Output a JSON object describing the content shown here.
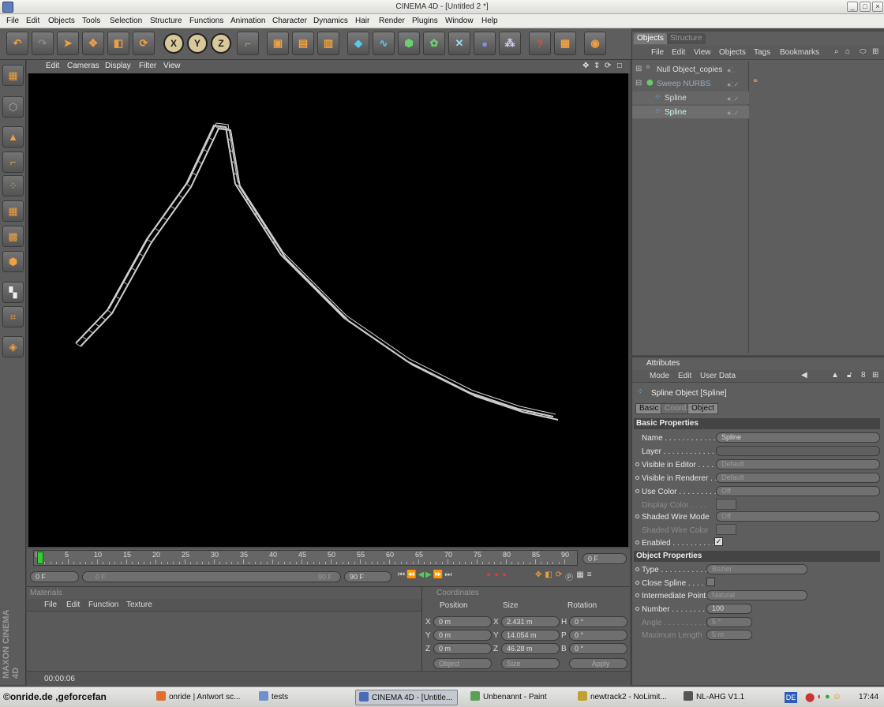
{
  "window": {
    "title": "CINEMA 4D - [Untitled 2 *]"
  },
  "menubar": [
    "File",
    "Edit",
    "Objects",
    "Tools",
    "Selection",
    "Structure",
    "Functions",
    "Animation",
    "Character",
    "Dynamics",
    "Hair",
    "Render",
    "Plugins",
    "Window",
    "Help"
  ],
  "viewport": {
    "menu": [
      "Edit",
      "Cameras",
      "Display",
      "Filter",
      "View"
    ]
  },
  "timeline": {
    "ticks": [
      "0",
      "5",
      "10",
      "15",
      "20",
      "25",
      "30",
      "35",
      "40",
      "45",
      "50",
      "55",
      "60",
      "65",
      "70",
      "75",
      "80",
      "85",
      "90"
    ],
    "current_frame": "0 F",
    "start_field": "0 F",
    "range_left": "0 F",
    "range_right": "90 F",
    "end_field": "90 F"
  },
  "materials": {
    "title": "Materials",
    "menu": [
      "File",
      "Edit",
      "Function",
      "Texture"
    ]
  },
  "coordinates": {
    "title": "Coordinates",
    "headers": [
      "Position",
      "Size",
      "Rotation"
    ],
    "rows": [
      {
        "axis": "X",
        "pos": "0 m",
        "saxis": "X",
        "size": "2.431 m",
        "raxis": "H",
        "rot": "0 °"
      },
      {
        "axis": "Y",
        "pos": "0 m",
        "saxis": "Y",
        "size": "14.054 m",
        "raxis": "P",
        "rot": "0 °"
      },
      {
        "axis": "Z",
        "pos": "0 m",
        "saxis": "Z",
        "size": "46.28 m",
        "raxis": "B",
        "rot": "0 °"
      }
    ],
    "mode": "Object",
    "size_mode": "Size",
    "apply": "Apply"
  },
  "status": {
    "time": "00:00:06"
  },
  "objects": {
    "tabs": [
      "Objects",
      "Structure"
    ],
    "menu": [
      "File",
      "Edit",
      "View",
      "Objects",
      "Tags",
      "Bookmarks"
    ],
    "items": [
      {
        "name": "Null Object_copies"
      },
      {
        "name": "Sweep NURBS"
      },
      {
        "name": "Spline"
      },
      {
        "name": "Spline"
      }
    ]
  },
  "attributes": {
    "title": "Attributes",
    "menu": [
      "Mode",
      "Edit",
      "User Data"
    ],
    "object_title": "Spline Object [Spline]",
    "tabs": [
      "Basic",
      "Coord.",
      "Object"
    ],
    "basic_header": "Basic Properties",
    "name_label": "Name . . . . . . . . . . . .",
    "name_value": "Spline",
    "layer_label": "Layer . . . . . . . . . . . .",
    "vis_editor_label": "Visible in Editor . . . . .",
    "vis_editor_value": "Default",
    "vis_render_label": "Visible in Renderer . .",
    "vis_render_value": "Default",
    "use_color_label": "Use Color . . . . . . . . .",
    "use_color_value": "Off",
    "display_color_label": "Display Color . . . .",
    "shaded_wire_label": "Shaded Wire Mode",
    "shaded_wire_value": "Off",
    "shaded_wire_color_label": "Shaded Wire Color",
    "enabled_label": "Enabled . . . . . . . . . .",
    "object_header": "Object Properties",
    "type_label": "Type . . . . . . . . . . .",
    "type_value": "Bezier",
    "close_label": "Close Spline . . . .",
    "inter_label": "Intermediate Points",
    "inter_value": "Natural",
    "number_label": "Number . . . . . . . .",
    "number_value": "100",
    "angle_label": "Angle . . . . . . . . . .",
    "angle_value": "5 °",
    "maxlen_label": "Maximum Length",
    "maxlen_value": "5 m"
  },
  "taskbar": {
    "items": [
      "onride | Antwort sc...",
      "tests",
      "CINEMA 4D - [Untitle...",
      "Unbenannt - Paint",
      "newtrack2 - NoLimit...",
      "NL-AHG V1.1"
    ],
    "lang": "DE",
    "clock": "17:44",
    "watermark": "©onride.de ,geforcefan"
  },
  "colors": {
    "accent": "#f0a040",
    "viewport_bg": "#000000",
    "panel": "#5e5e5e"
  }
}
